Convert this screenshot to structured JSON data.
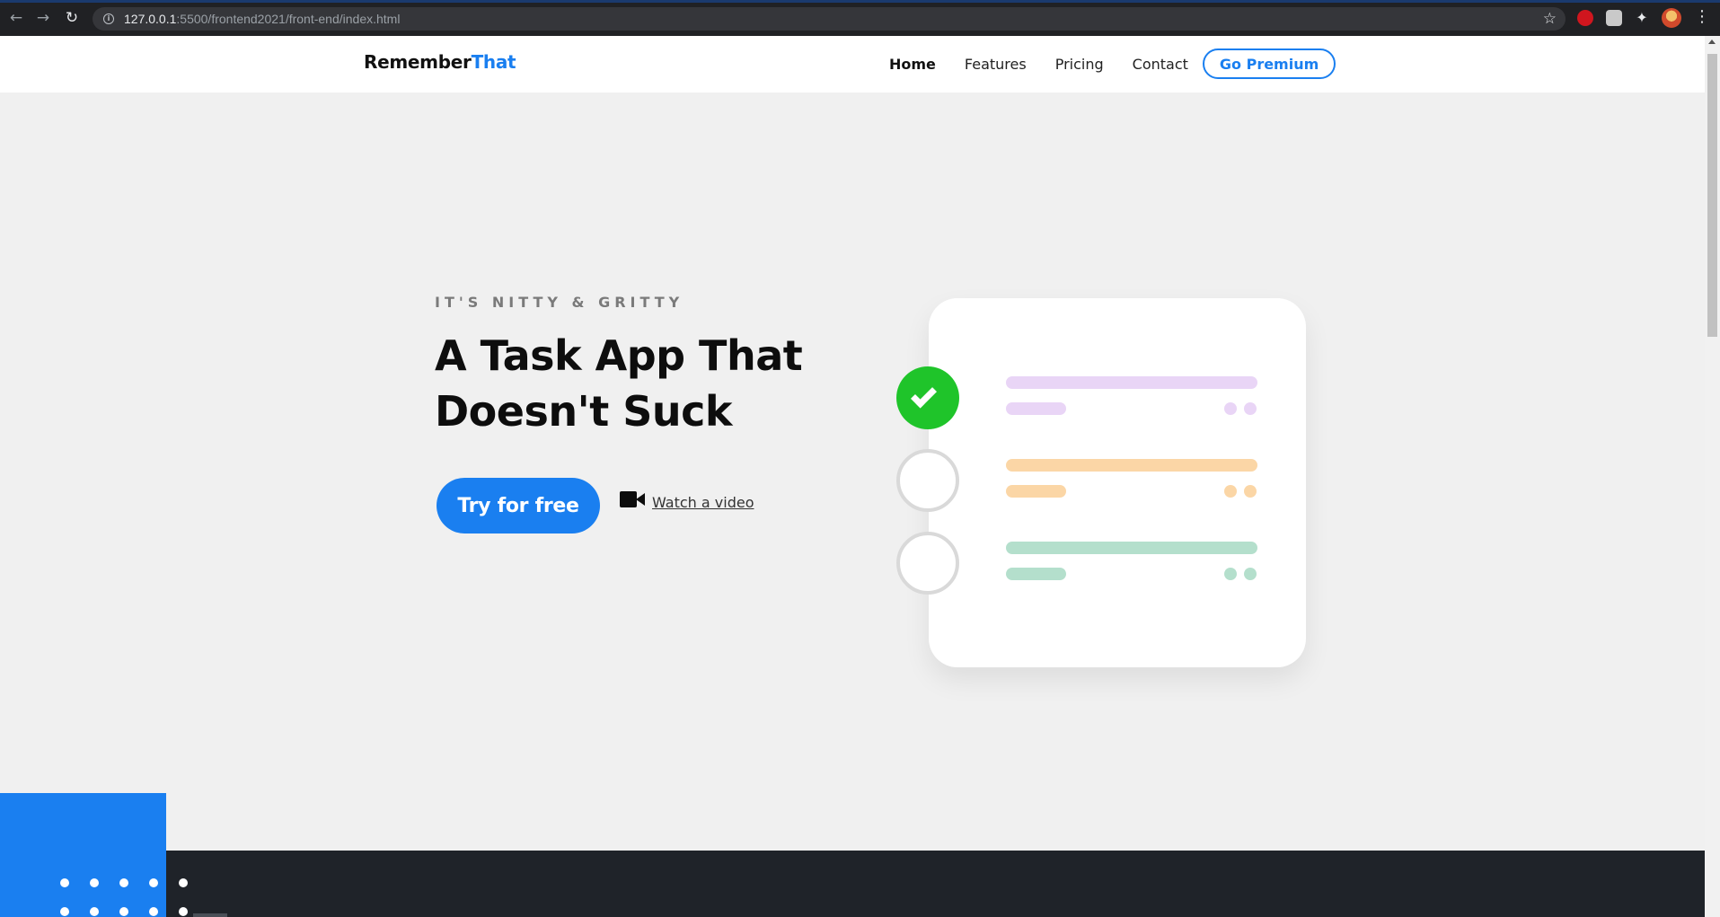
{
  "browser": {
    "url_host": "127.0.0.1",
    "url_rest": ":5500/frontend2021/front-end/index.html"
  },
  "header": {
    "logo_main": "Remember",
    "logo_accent": "That",
    "nav": [
      {
        "label": "Home",
        "active": true
      },
      {
        "label": "Features",
        "active": false
      },
      {
        "label": "Pricing",
        "active": false
      },
      {
        "label": "Contact",
        "active": false
      }
    ],
    "premium_label": "Go Premium"
  },
  "hero": {
    "eyebrow": "IT'S NITTY & GRITTY",
    "title": "A Task App That Doesn't Suck",
    "cta_label": "Try for free",
    "video_label": "Watch a video"
  },
  "illustration": {
    "tasks": [
      {
        "done": true,
        "color": "#e9d5f6"
      },
      {
        "done": false,
        "color": "#fbd6a6"
      },
      {
        "done": false,
        "color": "#b4dfcc"
      }
    ]
  },
  "colors": {
    "accent": "#1a7ff0",
    "check_green": "#1fc42a",
    "dark_band": "#1f2329"
  }
}
